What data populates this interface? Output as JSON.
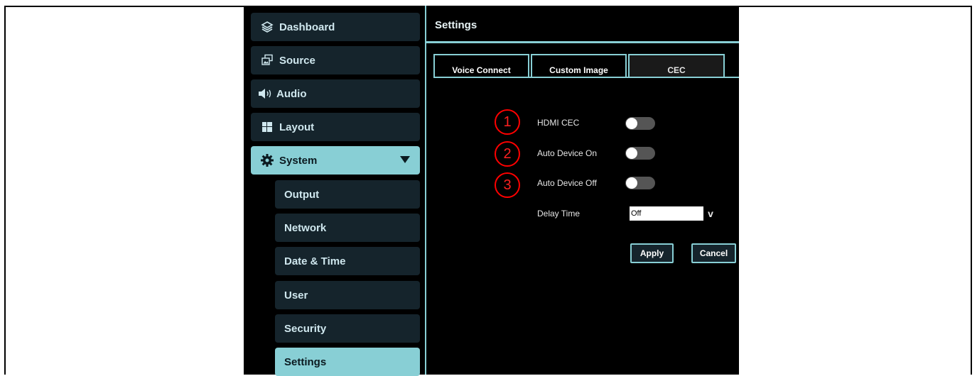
{
  "sidebar": {
    "items": [
      {
        "label": "Dashboard",
        "icon": "layers-icon"
      },
      {
        "label": "Source",
        "icon": "source-icon"
      },
      {
        "label": "Audio",
        "icon": "speaker-icon"
      },
      {
        "label": "Layout",
        "icon": "layout-icon"
      },
      {
        "label": "System",
        "icon": "gear-icon",
        "expanded_indicator": "▼"
      }
    ],
    "sub_items": [
      "Output",
      "Network",
      "Date & Time",
      "User",
      "Security",
      "Settings"
    ],
    "active_sub_item": "Settings"
  },
  "main": {
    "title": "Settings",
    "tabs": [
      "Voice Connect",
      "Custom Image",
      "CEC"
    ],
    "active_tab": "CEC",
    "rows": [
      {
        "marker": "1",
        "label": "HDMI CEC",
        "enabled": false
      },
      {
        "marker": "2",
        "label": "Auto Device On",
        "enabled": false
      },
      {
        "marker": "3",
        "label": "Auto Device Off",
        "enabled": false
      }
    ],
    "delay": {
      "label": "Delay Time",
      "value": "Off",
      "chevron": "v"
    },
    "apply_label": "Apply",
    "cancel_label": "Cancel"
  },
  "colors": {
    "accent": "#88cfd5",
    "panel": "#15242c",
    "annotation": "#ff0000"
  }
}
